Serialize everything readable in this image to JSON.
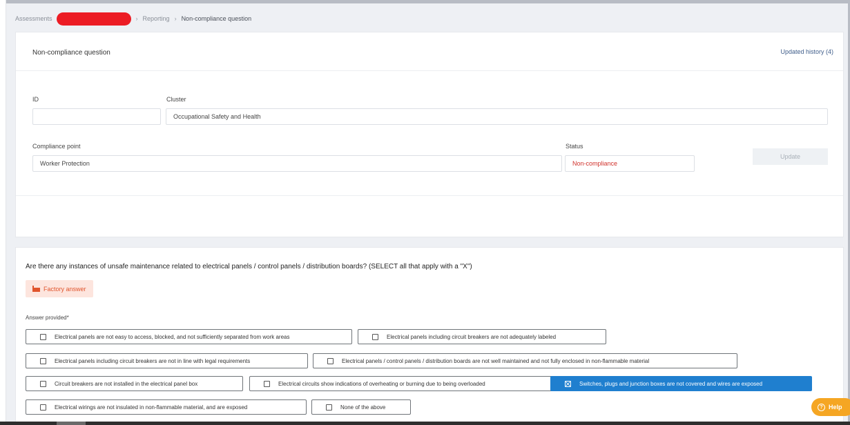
{
  "breadcrumb": {
    "items": [
      "Assessments",
      "Reporting",
      "Non-compliance question"
    ]
  },
  "header": {
    "title": "Non-compliance question",
    "history_link": "Updated history (4)"
  },
  "form": {
    "id_label": "ID",
    "id_value": "",
    "cluster_label": "Cluster",
    "cluster_value": "Occupational Safety and Health",
    "compliance_point_label": "Compliance point",
    "compliance_point_value": "Worker Protection",
    "status_label": "Status",
    "status_value": "Non-compliance",
    "update_label": "Update"
  },
  "question": {
    "text": "Are there any instances of unsafe maintenance related to electrical panels / control panels / distribution boards? (SELECT all that apply with a \"X\")",
    "factory_answer_label": "Factory answer",
    "answer_provided_label": "Answer provided*",
    "options": [
      {
        "label": "Electrical panels are not easy to access, blocked, and not sufficiently separated from work areas",
        "selected": false
      },
      {
        "label": "Electrical panels including circuit breakers are not adequately labeled",
        "selected": false
      },
      {
        "label": "Electrical panels including circuit breakers are not in line with legal requirements",
        "selected": false
      },
      {
        "label": "Electrical panels / control panels / distribution boards are not well maintained and not fully enclosed in non-flammable material",
        "selected": false
      },
      {
        "label": "Circuit breakers are not installed in the electrical panel box",
        "selected": false
      },
      {
        "label": "Electrical circuits show indications of overheating or burning due to being overloaded",
        "selected": false
      },
      {
        "label": "Switches, plugs and junction boxes are not covered and wires are exposed",
        "selected": true
      },
      {
        "label": "Electrical wirings are not insulated in non-flammable material, and are exposed",
        "selected": false
      },
      {
        "label": "None of the above",
        "selected": false
      }
    ]
  },
  "help": {
    "label": "Help"
  },
  "colors": {
    "accent": "#1f7fcf",
    "status_red": "#d0302a",
    "factory_tag_bg": "#fde5de",
    "factory_tag_fg": "#e0542c",
    "help_bg": "#f5a623"
  },
  "icons": {
    "factory": "factory-icon",
    "help": "help-circle-icon",
    "checkbox": "checkbox-icon"
  }
}
